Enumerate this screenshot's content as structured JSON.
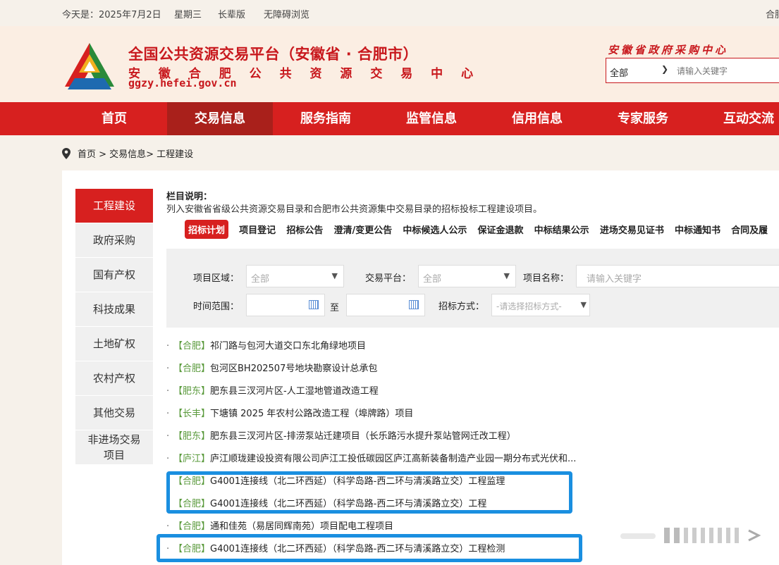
{
  "topbar": {
    "date": "今天是：2025年7月2日",
    "weekday": "星期三",
    "elder": "长辈版",
    "accessible": "无障碍浏览",
    "city": "合肥"
  },
  "header": {
    "title_main": "全国公共资源交易平台（安徽省 · 合肥市）",
    "title_sub": "安 徽 合 肥 公 共 资 源 交 易 中 心",
    "domain": "ggzy.hefei.gov.cn",
    "gov_text": "安徽省政府采购中心",
    "search_scope": "全部",
    "search_placeholder": "请输入关键字",
    "brand_color": "#c8181d"
  },
  "nav": [
    "首页",
    "交易信息",
    "服务指南",
    "监管信息",
    "信用信息",
    "专家服务",
    "互动交流"
  ],
  "breadcrumb": "首页 > 交易信息> 工程建设",
  "sidebar": [
    {
      "label": "工程建设",
      "active": true
    },
    {
      "label": "政府采购"
    },
    {
      "label": "国有产权"
    },
    {
      "label": "科技成果"
    },
    {
      "label": "土地矿权"
    },
    {
      "label": "农村产权"
    },
    {
      "label": "其他交易"
    },
    {
      "label": "非进场交易项目"
    }
  ],
  "column_desc": {
    "title": "栏目说明：",
    "text": "列入安徽省省级公共资源交易目录和合肥市公共资源集中交易目录的招标投标工程建设项目。"
  },
  "tabs": [
    "招标计划",
    "项目登记",
    "招标公告",
    "澄清/变更公告",
    "中标候选人公示",
    "保证金退款",
    "中标结果公示",
    "进场交易见证书",
    "中标通知书",
    "合同及履"
  ],
  "filter": {
    "region_label": "项目区域：",
    "region_value": "全部",
    "platform_label": "交易平台：",
    "platform_value": "全部",
    "name_label": "项目名称：",
    "name_placeholder": "请输入关键字",
    "time_label": "时间范围：",
    "to_label": "至",
    "method_label": "招标方式：",
    "method_placeholder": "-请选择招标方式-"
  },
  "list": [
    {
      "region": "【合肥】",
      "title": "祁门路与包河大道交口东北角绿地项目"
    },
    {
      "region": "【合肥】",
      "title": "包河区BH202507号地块勘察设计总承包"
    },
    {
      "region": "【肥东】",
      "title": "肥东县三汊河片区-人工湿地管道改造工程"
    },
    {
      "region": "【长丰】",
      "title": "下塘镇 2025 年农村公路改造工程（埠牌路）项目"
    },
    {
      "region": "【肥东】",
      "title": "肥东县三汊河片区-排涝泵站迁建项目（长乐路污水提升泵站管网迁改工程）"
    },
    {
      "region": "【庐江】",
      "title": "庐江顺珑建设投资有限公司庐江工投低碳园区庐江高新装备制造产业园一期分布式光伏和..."
    },
    {
      "region": "【合肥】",
      "title": "G4001连接线（北二环西延）（科学岛路-西二环与清溪路立交）工程监理"
    },
    {
      "region": "【合肥】",
      "title": "G4001连接线（北二环西延）（科学岛路-西二环与清溪路立交）工程"
    },
    {
      "region": "【合肥】",
      "title": "通和佳苑（易居同辉南苑）项目配电工程项目"
    },
    {
      "region": "【合肥】",
      "title": "G4001连接线（北二环西延）（科学岛路-西二环与清溪路立交）工程检测"
    }
  ]
}
